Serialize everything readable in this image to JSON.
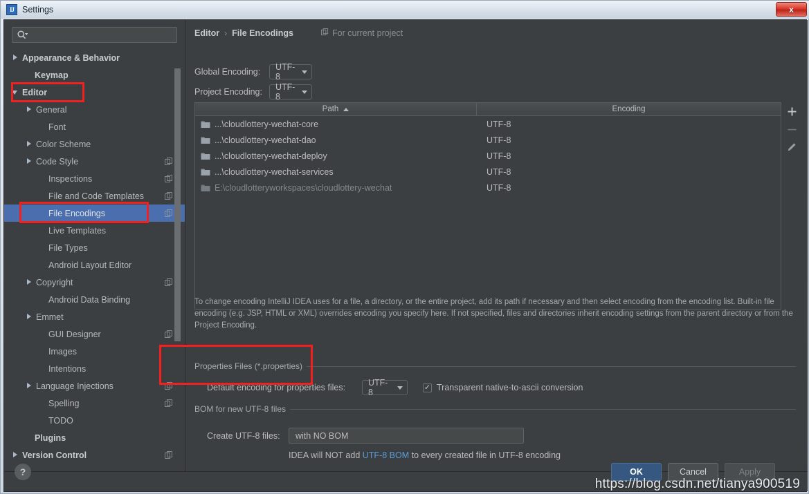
{
  "window": {
    "title": "Settings",
    "app_icon": "intellij-idea-icon",
    "close_label": "x"
  },
  "sidebar": {
    "search": {
      "placeholder": "",
      "value": "",
      "icon": "search-icon"
    },
    "items": [
      {
        "label": "Appearance & Behavior",
        "arrow": "right",
        "bold": true,
        "indent": 12,
        "project": false
      },
      {
        "label": "Keymap",
        "arrow": "none",
        "bold": true,
        "indent": 30,
        "project": false
      },
      {
        "label": "Editor",
        "arrow": "down",
        "bold": true,
        "indent": 12,
        "project": false
      },
      {
        "label": "General",
        "arrow": "right",
        "bold": false,
        "indent": 32,
        "project": false
      },
      {
        "label": "Font",
        "arrow": "none",
        "bold": false,
        "indent": 50,
        "project": false
      },
      {
        "label": "Color Scheme",
        "arrow": "right",
        "bold": false,
        "indent": 32,
        "project": false
      },
      {
        "label": "Code Style",
        "arrow": "right",
        "bold": false,
        "indent": 32,
        "project": true
      },
      {
        "label": "Inspections",
        "arrow": "none",
        "bold": false,
        "indent": 50,
        "project": true
      },
      {
        "label": "File and Code Templates",
        "arrow": "none",
        "bold": false,
        "indent": 50,
        "project": true
      },
      {
        "label": "File Encodings",
        "arrow": "none",
        "bold": false,
        "indent": 50,
        "project": true,
        "selected": true
      },
      {
        "label": "Live Templates",
        "arrow": "none",
        "bold": false,
        "indent": 50,
        "project": false
      },
      {
        "label": "File Types",
        "arrow": "none",
        "bold": false,
        "indent": 50,
        "project": false
      },
      {
        "label": "Android Layout Editor",
        "arrow": "none",
        "bold": false,
        "indent": 50,
        "project": false
      },
      {
        "label": "Copyright",
        "arrow": "right",
        "bold": false,
        "indent": 32,
        "project": true
      },
      {
        "label": "Android Data Binding",
        "arrow": "none",
        "bold": false,
        "indent": 50,
        "project": false
      },
      {
        "label": "Emmet",
        "arrow": "right",
        "bold": false,
        "indent": 32,
        "project": false
      },
      {
        "label": "GUI Designer",
        "arrow": "none",
        "bold": false,
        "indent": 50,
        "project": true
      },
      {
        "label": "Images",
        "arrow": "none",
        "bold": false,
        "indent": 50,
        "project": false
      },
      {
        "label": "Intentions",
        "arrow": "none",
        "bold": false,
        "indent": 50,
        "project": false
      },
      {
        "label": "Language Injections",
        "arrow": "right",
        "bold": false,
        "indent": 32,
        "project": true
      },
      {
        "label": "Spelling",
        "arrow": "none",
        "bold": false,
        "indent": 50,
        "project": true
      },
      {
        "label": "TODO",
        "arrow": "none",
        "bold": false,
        "indent": 50,
        "project": false
      },
      {
        "label": "Plugins",
        "arrow": "none",
        "bold": true,
        "indent": 30,
        "project": false
      },
      {
        "label": "Version Control",
        "arrow": "right",
        "bold": true,
        "indent": 12,
        "project": true
      }
    ]
  },
  "main": {
    "breadcrumb": {
      "parent": "Editor",
      "separator": "›",
      "current": "File Encodings",
      "scope_label": "For current project",
      "scope_icon": "project-scope-icon"
    },
    "global_encoding": {
      "label": "Global Encoding:",
      "value": "UTF-8"
    },
    "project_encoding": {
      "label": "Project Encoding:",
      "value": "UTF-8"
    },
    "table": {
      "columns": [
        "Path",
        "Encoding"
      ],
      "sort_column": "Path",
      "sort_direction": "asc",
      "rows": [
        {
          "path_prefix": "",
          "path": "...\\cloudlottery-wechat-core",
          "encoding": "UTF-8",
          "dim": false
        },
        {
          "path_prefix": "",
          "path": "...\\cloudlottery-wechat-dao",
          "encoding": "UTF-8",
          "dim": false
        },
        {
          "path_prefix": "",
          "path": "...\\cloudlottery-wechat-deploy",
          "encoding": "UTF-8",
          "dim": false
        },
        {
          "path_prefix": "",
          "path": "...\\cloudlottery-wechat-services",
          "encoding": "UTF-8",
          "dim": false
        },
        {
          "path_prefix": "E:\\cloudlotteryworkspaces\\",
          "path": "cloudlottery-wechat",
          "encoding": "UTF-8",
          "dim": true
        }
      ],
      "toolbar": [
        {
          "name": "add-button",
          "glyph": "+"
        },
        {
          "name": "remove-button",
          "glyph": "−"
        },
        {
          "name": "edit-button",
          "glyph": "pencil"
        }
      ]
    },
    "description": "To change encoding IntelliJ IDEA uses for a file, a directory, or the entire project, add its path if necessary and then select encoding from the encoding list. Built-in file encoding (e.g. JSP, HTML or XML) overrides encoding you specify here. If not specified, files and directories inherit encoding settings from the parent directory or from the Project Encoding.",
    "properties_group": {
      "title": "Properties Files (*.properties)",
      "default_encoding_label": "Default encoding for properties files:",
      "default_encoding_value": "UTF-8",
      "transparent_label": "Transparent native-to-ascii conversion",
      "transparent_checked": true,
      "check_glyph": "✓"
    },
    "bom_group": {
      "title": "BOM for new UTF-8 files",
      "create_label": "Create UTF-8 files:",
      "create_value": "with NO BOM",
      "note_prefix": "IDEA will NOT add ",
      "note_link": "UTF-8 BOM",
      "note_suffix": " to every created file in UTF-8 encoding"
    }
  },
  "footer": {
    "help": "?",
    "ok": "OK",
    "cancel": "Cancel",
    "apply": "Apply"
  },
  "watermark": "https://blog.csdn.net/tianya900519",
  "colors": {
    "panel_bg": "#3c3f41",
    "selection": "#4b6eaf",
    "accent_ok": "#365880",
    "link": "#5b9bd5",
    "annotation": "#f41f1f",
    "text": "#bbbbbb"
  }
}
